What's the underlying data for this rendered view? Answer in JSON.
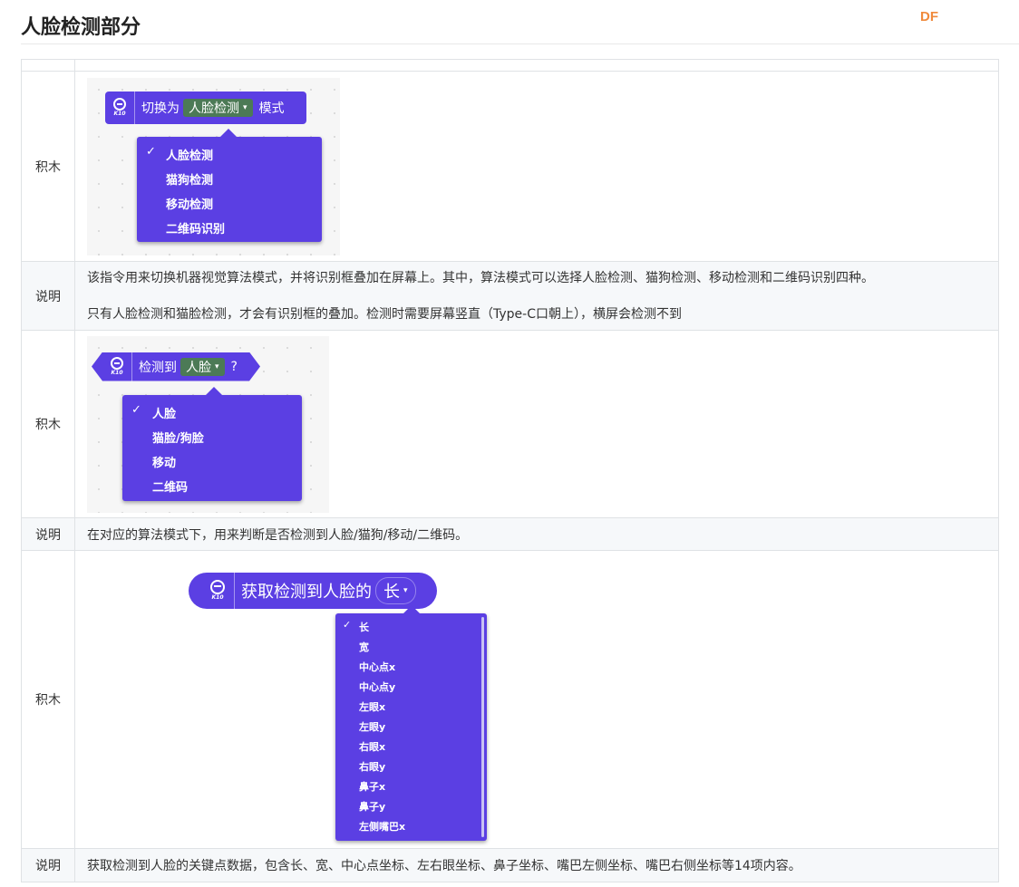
{
  "page_title": "人脸检测部分",
  "brand": "DF",
  "labels": {
    "block": "积木",
    "desc": "说明"
  },
  "block1": {
    "prefix": "切换为",
    "selected": "人脸检测",
    "suffix": "模式",
    "options": [
      "人脸检测",
      "猫狗检测",
      "移动检测",
      "二维码识别"
    ]
  },
  "desc1": {
    "line1": "该指令用来切换机器视觉算法模式，并将识别框叠加在屏幕上。其中，算法模式可以选择人脸检测、猫狗检测、移动检测和二维码识别四种。",
    "line2": "只有人脸检测和猫脸检测，才会有识别框的叠加。检测时需要屏幕竖直（Type-C口朝上），横屏会检测不到"
  },
  "block2": {
    "prefix": "检测到",
    "selected": "人脸",
    "suffix": "?",
    "options": [
      "人脸",
      "猫脸/狗脸",
      "移动",
      "二维码"
    ]
  },
  "desc2": "在对应的算法模式下，用来判断是否检测到人脸/猫狗/移动/二维码。",
  "block3": {
    "prefix": "获取检测到人脸的",
    "selected": "长",
    "options": [
      "长",
      "宽",
      "中心点x",
      "中心点y",
      "左眼x",
      "左眼y",
      "右眼x",
      "右眼y",
      "鼻子x",
      "鼻子y",
      "左侧嘴巴x"
    ]
  },
  "desc3": "获取检测到人脸的关键点数据，包含长、宽、中心点坐标、左右眼坐标、鼻子坐标、嘴巴左侧坐标、嘴巴右侧坐标等14项内容。",
  "icons": {
    "k10_label": "K10",
    "checkmark": "✓",
    "dropdown_arrow": "▾"
  },
  "colors": {
    "block": "#5b3fe3",
    "dropdown_field": "#4c7a56",
    "brand": "#f08a3c"
  }
}
